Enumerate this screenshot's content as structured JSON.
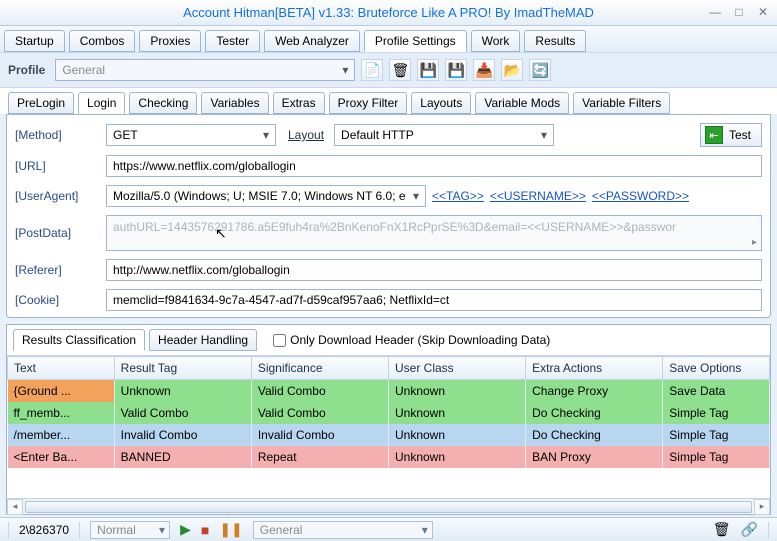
{
  "title": "Account Hitman[BETA] v1.33: Bruteforce Like A PRO!  By ImadTheMAD",
  "main_tabs": [
    "Startup",
    "Combos",
    "Proxies",
    "Tester",
    "Web Analyzer",
    "Profile Settings",
    "Work",
    "Results"
  ],
  "main_active": 5,
  "profile_label": "Profile",
  "profile_value": "General",
  "sub_tabs": [
    "PreLogin",
    "Login",
    "Checking",
    "Variables",
    "Extras",
    "Proxy Filter",
    "Layouts",
    "Variable Mods",
    "Variable Filters"
  ],
  "sub_active": 1,
  "form": {
    "method_label": "[Method]",
    "method_value": "GET",
    "layout_label": "Layout",
    "layout_value": "Default HTTP",
    "test_label": "Test",
    "url_label": "[URL]",
    "url_value": "https://www.netflix.com/globallogin",
    "ua_label": "[UserAgent]",
    "ua_value": "Mozilla/5.0 (Windows; U; MSIE 7.0; Windows NT 6.0; e",
    "tag_link": "<<TAG>>",
    "user_link": "<<USERNAME>>",
    "pass_link": "<<PASSWORD>>",
    "post_label": "[PostData]",
    "post_value": "authURL=1443576291786.a5E9fuh4ra%2BnKenoFnX1RcPprSE%3D&email=<<USERNAME>>&passwor",
    "ref_label": "[Referer]",
    "ref_value": "http://www.netflix.com/globallogin",
    "cookie_label": "[Cookie]",
    "cookie_value": "memclid=f9841634-9c7a-4547-ad7f-d59caf957aa6; NetflixId=ct"
  },
  "results": {
    "tabs": [
      "Results Classification",
      "Header Handling"
    ],
    "active": 0,
    "check_label": "Only Download Header (Skip Downloading Data)",
    "cols": [
      "Text",
      "Result Tag",
      "Significance",
      "User Class",
      "Extra Actions",
      "Save Options"
    ],
    "rows": [
      {
        "cls": "r-orange",
        "cells": [
          "{Ground ...",
          "Unknown",
          "Valid Combo",
          "Unknown",
          "Change Proxy",
          "Save Data"
        ]
      },
      {
        "cls": "r-green",
        "cells": [
          "ff_memb...",
          "Valid Combo",
          "Valid Combo",
          "Unknown",
          "Do Checking",
          "Simple Tag"
        ]
      },
      {
        "cls": "r-blue",
        "cells": [
          "/member...",
          "Invalid Combo",
          "Invalid Combo",
          "Unknown",
          "Do Checking",
          "Simple Tag"
        ]
      },
      {
        "cls": "r-pink",
        "cells": [
          "<Enter Ba...",
          "BANNED",
          "Repeat",
          "Unknown",
          "BAN Proxy",
          "Simple Tag"
        ]
      }
    ]
  },
  "status": {
    "progress": "2\\826370",
    "mode": "Normal",
    "list": "General"
  }
}
